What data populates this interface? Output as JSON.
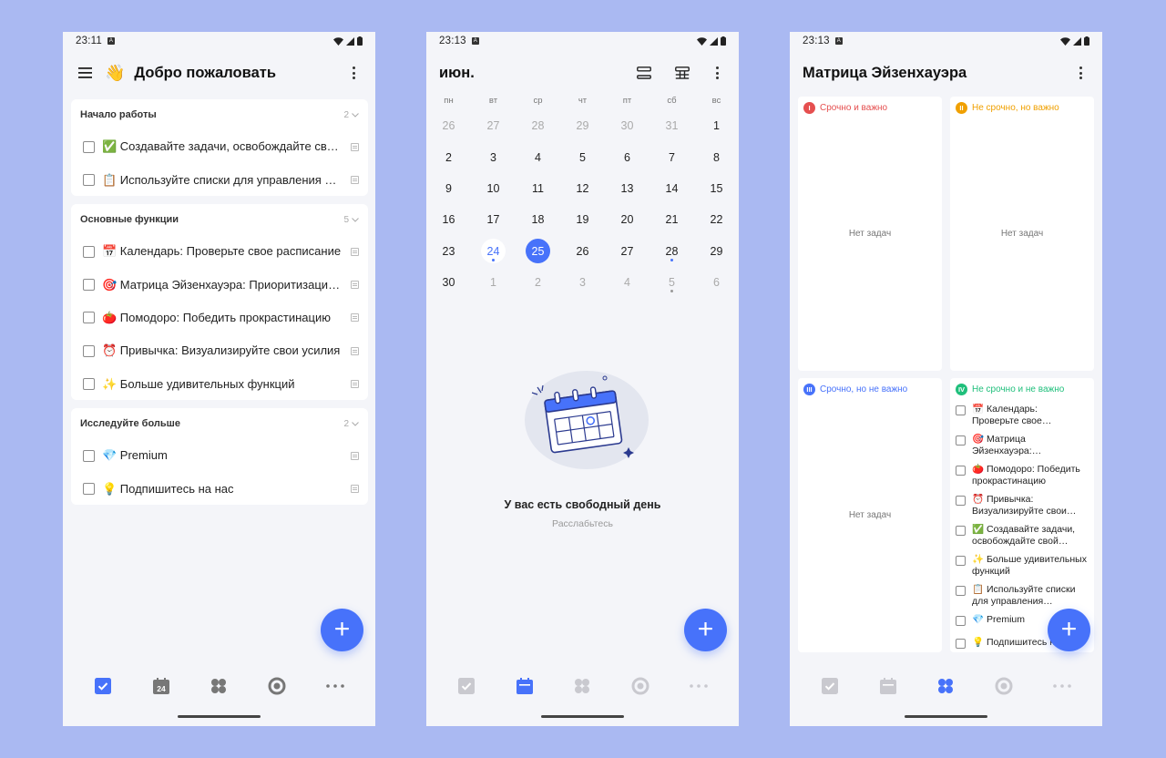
{
  "colors": {
    "accent": "#4772fa",
    "background": "#aab9f2",
    "screen": "#f4f5f9",
    "q1": "#e54f4f",
    "q2": "#f0a000",
    "q3": "#4772fa",
    "q4": "#1fbf7b"
  },
  "screen1": {
    "status_time": "23:11",
    "sim_label": "A",
    "wave_emoji": "👋",
    "title": "Добро пожаловать",
    "sections": [
      {
        "title": "Начало работы",
        "count": "2",
        "tasks": [
          "✅ Создавайте задачи, освобождайте свой разум",
          "📋 Используйте списки для управления задачами"
        ]
      },
      {
        "title": "Основные функции",
        "count": "5",
        "tasks": [
          "📅 Календарь: Проверьте свое расписание",
          "🎯 Матрица Эйзенхауэра: Приоритизация задач",
          "🍅 Помодоро: Победить прокрастинацию",
          "⏰ Привычка: Визуализируйте свои усилия",
          "✨ Больше удивительных функций"
        ]
      },
      {
        "title": "Исследуйте больше",
        "count": "2",
        "tasks": [
          "💎 Premium",
          "💡 Подпишитесь на нас"
        ]
      }
    ],
    "fab_label": "+",
    "nav_calendar_day": "24"
  },
  "screen2": {
    "status_time": "23:13",
    "sim_label": "A",
    "month": "июн.",
    "weekdays": [
      "пн",
      "вт",
      "ср",
      "чт",
      "пт",
      "сб",
      "вс"
    ],
    "days": [
      {
        "n": "26",
        "muted": true
      },
      {
        "n": "27",
        "muted": true
      },
      {
        "n": "28",
        "muted": true
      },
      {
        "n": "29",
        "muted": true
      },
      {
        "n": "30",
        "muted": true
      },
      {
        "n": "31",
        "muted": true
      },
      {
        "n": "1"
      },
      {
        "n": "2"
      },
      {
        "n": "3"
      },
      {
        "n": "4"
      },
      {
        "n": "5"
      },
      {
        "n": "6"
      },
      {
        "n": "7"
      },
      {
        "n": "8"
      },
      {
        "n": "9"
      },
      {
        "n": "10"
      },
      {
        "n": "11"
      },
      {
        "n": "12"
      },
      {
        "n": "13"
      },
      {
        "n": "14"
      },
      {
        "n": "15"
      },
      {
        "n": "16"
      },
      {
        "n": "17"
      },
      {
        "n": "18"
      },
      {
        "n": "19"
      },
      {
        "n": "20"
      },
      {
        "n": "21"
      },
      {
        "n": "22"
      },
      {
        "n": "23"
      },
      {
        "n": "24",
        "today": true,
        "dot": "blue"
      },
      {
        "n": "25",
        "selected": true
      },
      {
        "n": "26"
      },
      {
        "n": "27"
      },
      {
        "n": "28",
        "dot": "blue"
      },
      {
        "n": "29"
      },
      {
        "n": "30"
      },
      {
        "n": "1",
        "muted": true
      },
      {
        "n": "2",
        "muted": true
      },
      {
        "n": "3",
        "muted": true
      },
      {
        "n": "4",
        "muted": true
      },
      {
        "n": "5",
        "muted": true,
        "dot": "grey"
      },
      {
        "n": "6",
        "muted": true
      }
    ],
    "empty_title": "У вас есть свободный день",
    "empty_subtitle": "Расслабьтесь",
    "fab_label": "+"
  },
  "screen3": {
    "status_time": "23:13",
    "sim_label": "A",
    "title": "Матрица Эйзенхауэра",
    "quadrants": [
      {
        "badge": "I",
        "label": "Срочно и важно",
        "empty": "Нет задач",
        "tasks": []
      },
      {
        "badge": "II",
        "label": "Не срочно, но важно",
        "empty": "Нет задач",
        "tasks": []
      },
      {
        "badge": "III",
        "label": "Срочно, но не важно",
        "empty": "Нет задач",
        "tasks": []
      },
      {
        "badge": "IV",
        "label": "Не срочно и не важно",
        "empty": "",
        "tasks": [
          "📅 Календарь: Проверьте свое расписание",
          "🎯 Матрица Эйзенхауэра: Приоритизация задач",
          "🍅 Помодоро: Победить прокрастинацию",
          "⏰ Привычка: Визуализируйте свои усилия",
          "✅ Создавайте задачи, освобождайте свой разум",
          "✨ Больше удивительных функций",
          "📋 Используйте списки для управления задачами",
          "💎 Premium",
          "💡 Подпишитесь на нас"
        ]
      }
    ],
    "fab_label": "+",
    "nav_calendar_day": ""
  }
}
